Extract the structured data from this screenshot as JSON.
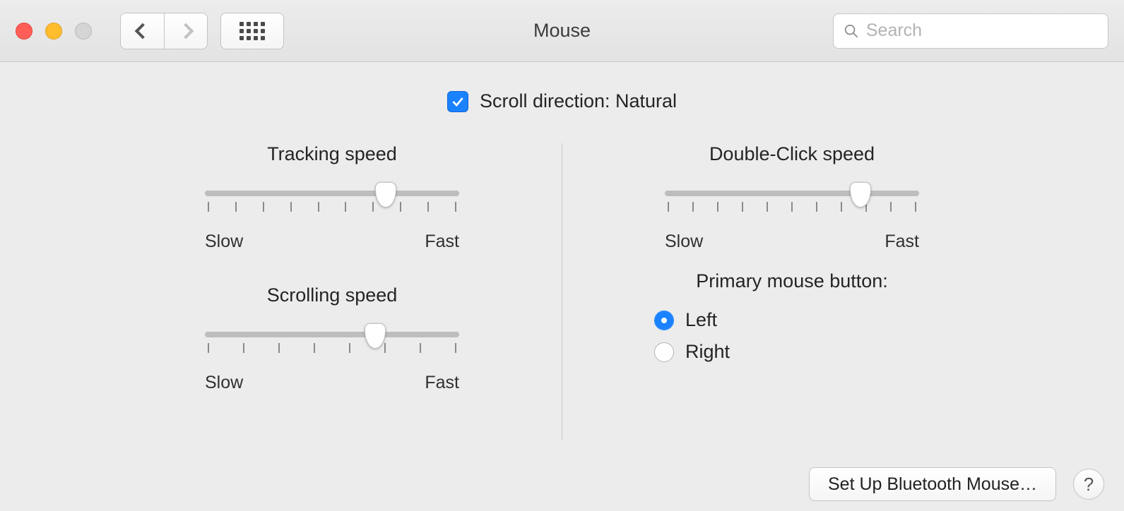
{
  "window": {
    "title": "Mouse",
    "search_placeholder": "Search"
  },
  "scroll_direction": {
    "label": "Scroll direction: Natural",
    "checked": true
  },
  "sliders": {
    "tracking": {
      "title": "Tracking speed",
      "min_label": "Slow",
      "max_label": "Fast",
      "ticks": 10,
      "value_percent": 71
    },
    "scrolling": {
      "title": "Scrolling speed",
      "min_label": "Slow",
      "max_label": "Fast",
      "ticks": 8,
      "value_percent": 67
    },
    "doubleclick": {
      "title": "Double-Click speed",
      "min_label": "Slow",
      "max_label": "Fast",
      "ticks": 11,
      "value_percent": 77
    }
  },
  "primary_button": {
    "title": "Primary mouse button:",
    "options": {
      "left": "Left",
      "right": "Right"
    },
    "selected": "left"
  },
  "footer": {
    "bluetooth_button": "Set Up Bluetooth Mouse…",
    "help_button": "?"
  }
}
